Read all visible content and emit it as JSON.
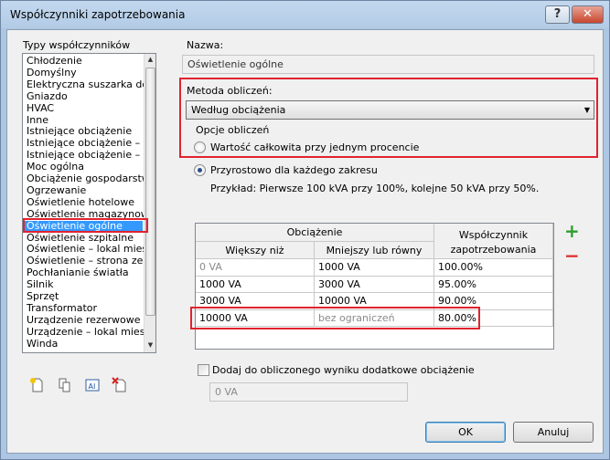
{
  "window": {
    "title": "Współczynniki zapotrzebowania",
    "help_label": "?",
    "close_label": "✕"
  },
  "types": {
    "label": "Typy współczynników",
    "items": [
      "Chłodzenie",
      "Domyślny",
      "Elektryczna suszarka do ub",
      "Gniazdo",
      "HVAC",
      "Inne",
      "Istniejące obciążenie",
      "Istniejące obciążenie – obc",
      "Istniejące obciążenie – ośw",
      "Moc ogólna",
      "Obciążenie gospodarstwa d",
      "Ogrzewanie",
      "Oświetlenie hotelowe",
      "Oświetlenie magazynowe",
      "Oświetlenie ogólne",
      "Oświetlenie szpitalne",
      "Oświetlenie – lokal mieszka",
      "Oświetlenie – strona zewnę",
      "Pochłanianie światła",
      "Silnik",
      "Sprzęt",
      "Transformator",
      "Urządzenie rezerwowe",
      "Urządzenie – lokal mieszka",
      "Winda"
    ],
    "selected_index": 14,
    "scroll_up": "▲",
    "scroll_down": "▼"
  },
  "name": {
    "label": "Nazwa:",
    "value": "Oświetlenie ogólne"
  },
  "method": {
    "label": "Metoda obliczeń:",
    "selected": "Według obciążenia",
    "arrow": "▼"
  },
  "options": {
    "label": "Opcje obliczeń",
    "radio_total": "Wartość całkowita przy jednym procencie",
    "radio_incremental": "Przyrostowo dla każdego zakresu",
    "selected": "incremental",
    "example": "Przykład: Pierwsze 100 kVA przy 100%, kolejne 50 kVA przy 50%."
  },
  "table": {
    "group_header": "Obciążenie",
    "col_greater": "Większy niż",
    "col_less": "Mniejszy lub równy",
    "col_factor_1": "Współczynnik",
    "col_factor_2": "zapotrzebowania",
    "rows": [
      {
        "greater": "0 VA",
        "less": "1000 VA",
        "factor": "100.00%"
      },
      {
        "greater": "1000 VA",
        "less": "3000 VA",
        "factor": "95.00%"
      },
      {
        "greater": "3000 VA",
        "less": "10000 VA",
        "factor": "90.00%"
      },
      {
        "greater": "10000 VA",
        "less": "bez ograniczeń",
        "factor": "80.00%"
      }
    ]
  },
  "add_row": "+",
  "remove_row": "−",
  "additional": {
    "label": "Dodaj do obliczonego wyniku dodatkowe obciążenie",
    "checked": false,
    "value": "0 VA"
  },
  "buttons": {
    "ok": "OK",
    "cancel": "Anuluj"
  },
  "colors": {
    "highlight": "#e0232e",
    "selection": "#3399ff",
    "accent_green": "#2e9e2e",
    "accent_red": "#e03030"
  }
}
